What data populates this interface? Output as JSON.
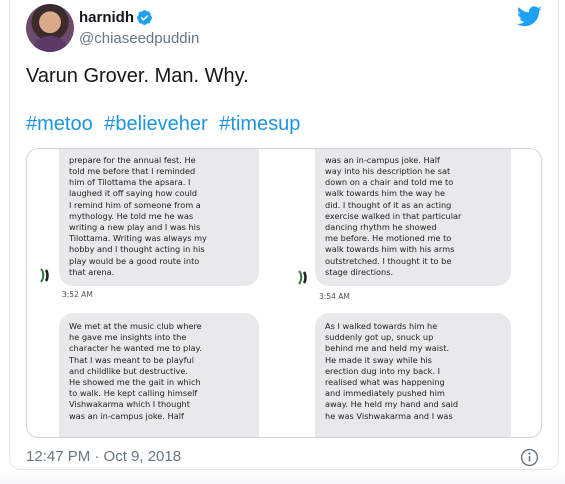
{
  "author": {
    "display_name": "harnidh",
    "handle": "@chiaseedpuddin",
    "avatar_icon": "profile-photo",
    "verified_icon": "verified-badge-icon"
  },
  "brand": {
    "icon": "twitter-bird-icon",
    "color": "#1da1f2"
  },
  "tweet": {
    "text": "Varun Grover. Man. Why.",
    "hashtags": [
      "#metoo",
      "#believeher",
      "#timesup"
    ],
    "hashtag_color": "#1b95e0",
    "timestamp": "12:47 PM · Oct 9, 2018"
  },
  "media": {
    "screenshot": {
      "left_column": {
        "top_message": [
          "prepare for the annual fest. He",
          "told me before that I reminded",
          "him of Tilottama the apsara. I",
          "laughed it off saying how could",
          "I remind him of someone from a",
          "mythology. He told me he was",
          "writing a new play and I was his",
          "Tilottama. Writing was always my",
          "hobby and I thought acting in his",
          "play would be a good route into",
          "that arena."
        ],
        "top_time": "3:52 AM",
        "bottom_message": [
          "We met at the music club where",
          "he gave me insights into the",
          "character he wanted me to play.",
          "That I was meant to be playful",
          "and childlike but destructive.",
          "He showed me the gait in which",
          "to walk. He kept calling himself",
          "Vishwakarma which I thought",
          "was an in-campus joke. Half"
        ]
      },
      "right_column": {
        "top_message": [
          "was an in-campus joke. Half",
          "way into his description he sat",
          "down on a chair and told me to",
          "walk towards him the way he",
          "did. I thought of it as an acting",
          "exercise walked in that particular",
          "dancing rhythm he showed",
          "me before. He motioned me to",
          "walk towards him with his arms",
          "outstretched. I thought it to be",
          "stage directions."
        ],
        "top_time": "3:54 AM",
        "bottom_message": [
          "As I walked towards him he",
          "suddenly got up, snuck up",
          "behind me and held my waist.",
          "He made it sway while his",
          "erection dug into my back. I",
          "realised what was happening",
          "and immediately pushed him",
          "away. He held my hand and said",
          "he was Vishwakarma and I was"
        ]
      }
    }
  },
  "actions": {
    "info_icon": "info-icon"
  }
}
